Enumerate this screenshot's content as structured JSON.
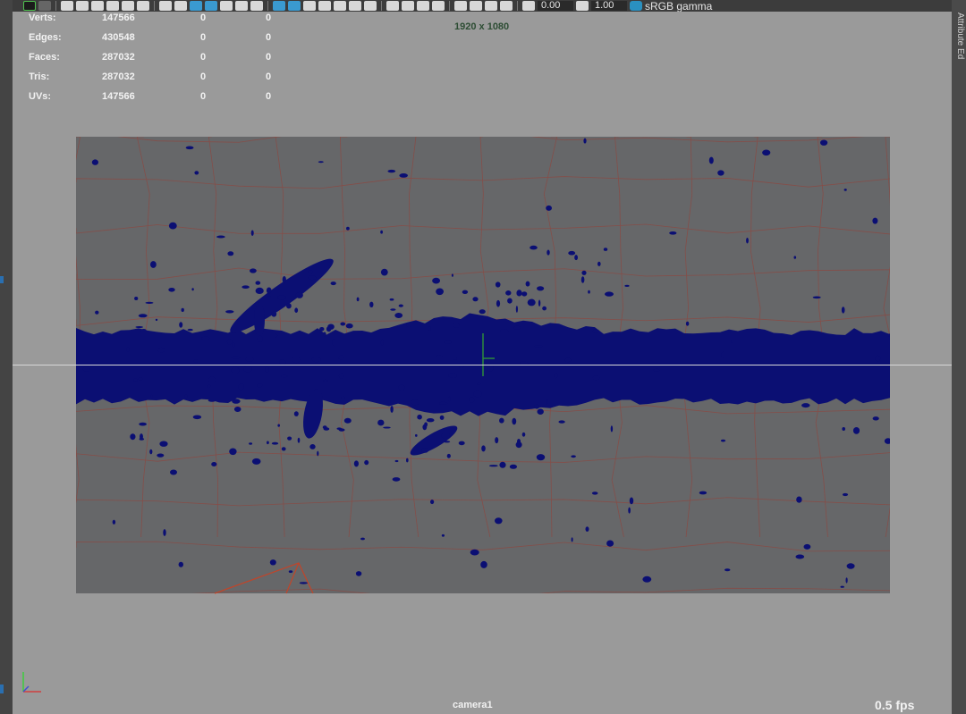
{
  "toolbar": {
    "exposure_value": "0.00",
    "gamma_value": "1.00",
    "color_space_label": "sRGB gamma"
  },
  "right_panel": {
    "tab_label": "Attribute Ed"
  },
  "hud": {
    "rows": [
      {
        "label": "Verts:",
        "v1": "147566",
        "v2": "0",
        "v3": "0"
      },
      {
        "label": "Edges:",
        "v1": "430548",
        "v2": "0",
        "v3": "0"
      },
      {
        "label": "Faces:",
        "v1": "287032",
        "v2": "0",
        "v3": "0"
      },
      {
        "label": "Tris:",
        "v1": "287032",
        "v2": "0",
        "v3": "0"
      },
      {
        "label": "UVs:",
        "v1": "147566",
        "v2": "0",
        "v3": "0"
      }
    ],
    "resolution": "1920 x 1080",
    "camera": "camera1",
    "fps": "0.5 fps"
  },
  "colors": {
    "viewport_bg": "#9a9a9a",
    "gate_bg": "#666769",
    "mesh_blue": "#0b0f73",
    "wire_red": "#8a4a44",
    "hud_text": "#f2f2f2"
  }
}
